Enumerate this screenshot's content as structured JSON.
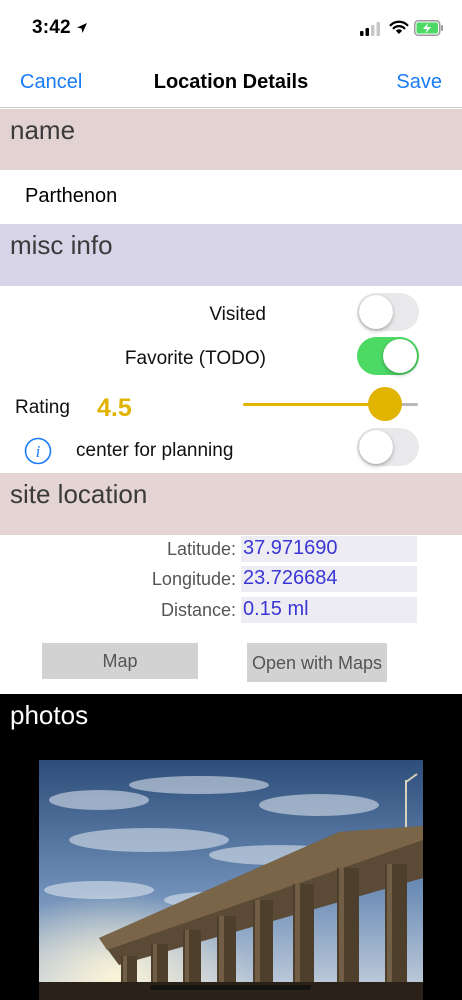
{
  "status_bar": {
    "time": "3:42",
    "icons": [
      "location-arrow-icon",
      "signal-icon",
      "wifi-icon",
      "battery-charging-icon"
    ],
    "battery_color": "#4cd964"
  },
  "nav": {
    "cancel_label": "Cancel",
    "title": "Location Details",
    "save_label": "Save",
    "accent_color": "#1a7cf5"
  },
  "sections": {
    "name_header": "name",
    "misc_header": "misc info",
    "site_header": "site location",
    "photos_header": "photos"
  },
  "name": {
    "value": "Parthenon"
  },
  "misc": {
    "visited_label": "Visited",
    "visited_on": false,
    "favorite_label": "Favorite (TODO)",
    "favorite_on": true,
    "rating_label": "Rating",
    "rating_value": "4.5",
    "rating_fraction": 0.9,
    "rating_color": "#e0b400",
    "center_label": "center for planning",
    "center_on": false,
    "info_icon": "info-icon"
  },
  "site": {
    "latitude_label": "Latitude:",
    "latitude_value": "37.971690",
    "longitude_label": "Longitude:",
    "longitude_value": "23.726684",
    "distance_label": "Distance:",
    "distance_value": "0.15 ml",
    "value_color": "#3b36d6"
  },
  "buttons": {
    "map_label": "Map",
    "open_maps_label": "Open with Maps"
  }
}
